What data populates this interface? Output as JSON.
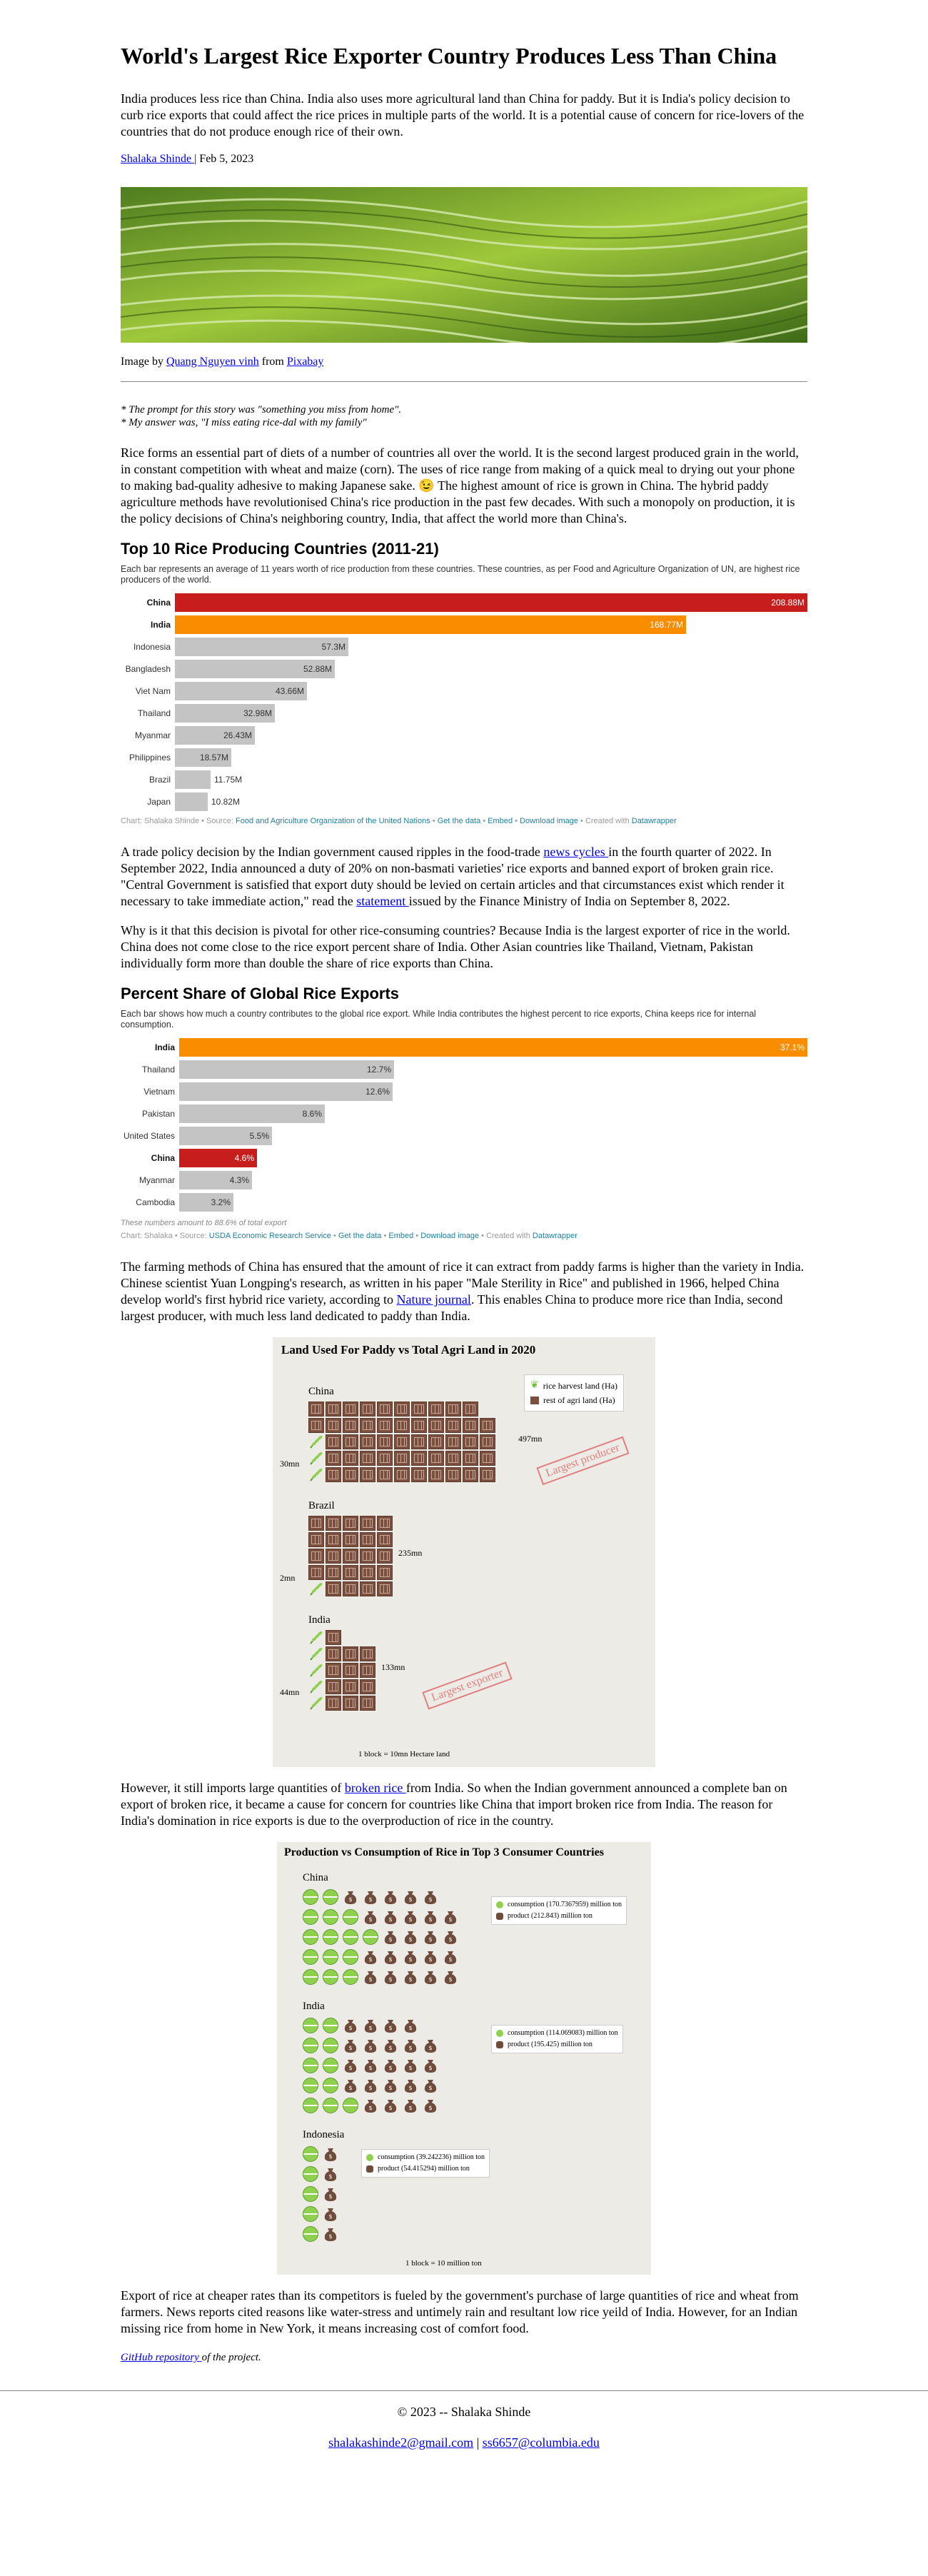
{
  "article": {
    "title": "World's Largest Rice Exporter Country Produces Less Than China",
    "intro": "India produces less rice than China. India also uses more agricultural land than China for paddy. But it is India's policy decision to curb rice exports that could affect the rice prices in multiple parts of the world. It is a potential cause of concern for rice-lovers of the countries that do not produce enough rice of their own.",
    "author": "Shalaka Shinde ",
    "date": " | Feb 5, 2023",
    "caption_pre": "Image by ",
    "caption_author": "Quang Nguyen vinh",
    "caption_mid": " from ",
    "caption_source": "Pixabay",
    "prompt_line1": "* The prompt for this story was \"something you miss from home\".",
    "prompt_line2": "* My answer was, \"I miss eating rice-dal with my family\"",
    "para1_a": "Rice forms an essential part of diets of a number of countries all over the world. It is the second largest produced grain in the world, in constant competition with wheat and maize (corn). The uses of rice range from making of a quick meal to drying out your phone to making bad-quality adhesive to making Japanese sake. ",
    "para1_emoji": "😉",
    "para1_b": " The highest amount of rice is grown in China. The hybrid paddy agriculture methods have revolutionised China's rice production in the past few decades. With such a monopoly on production, it is the policy decisions of China's neighboring country, India, that affect the world more than China's.",
    "para2_a": "A trade policy decision by the Indian government caused ripples in the food-trade ",
    "para2_link1": "news cycles ",
    "para2_b": "in the fourth quarter of 2022. In September 2022, India announced a duty of 20% on non-basmati varieties' rice exports and banned export of broken grain rice. \"Central Government is satisfied that export duty should be levied on certain articles and that circumstances exist which render it necessary to take immediate action,\" read the ",
    "para2_link2": "statement ",
    "para2_c": "issued by the Finance Ministry of India on September 8, 2022.",
    "para3": "Why is it that this decision is pivotal for other rice-consuming countries? Because India is the largest exporter of rice in the world. China does not come close to the rice export percent share of India. Other Asian countries like Thailand, Vietnam, Pakistan individually form more than double the share of rice exports than China.",
    "para4_a": "The farming methods of China has ensured that the amount of rice it can extract from paddy farms is higher than the variety in India. Chinese scientist Yuan Longping's research, as written in his paper \"Male Sterility in Rice\" and published in 1966, helped China develop world's first hybrid rice variety, according to ",
    "para4_link": "Nature journal",
    "para4_b": ". This enables China to produce more rice than India, second largest producer, with much less land dedicated to paddy than India.",
    "para5_a": "However, it still imports large quantities of ",
    "para5_link": "broken rice ",
    "para5_b": "from India. So when the Indian government announced a complete ban on export of broken rice, it became a cause for concern for countries like China that import broken rice from India. The reason for India's domination in rice exports is due to the overproduction of rice in the country.",
    "para6": "Export of rice at cheaper rates than its competitors is fueled by the government's purchase of large quantities of rice and wheat from farmers. News reports cited reasons like water-stress and untimely rain and resultant low rice yeild of India. However, for an Indian missing rice from home in New York, it means increasing cost of comfort food.",
    "github_link": "GitHub repository ",
    "github_tail": "of the project."
  },
  "chart_data": [
    {
      "type": "bar",
      "title": "Top 10 Rice Producing Countries (2011-21)",
      "description": "Each bar represents an average of 11 years worth of rice production from these countries. These countries, as per Food and Agriculture Organization of UN, are highest rice producers of the world.",
      "categories": [
        "China",
        "India",
        "Indonesia",
        "Bangladesh",
        "Viet Nam",
        "Thailand",
        "Myanmar",
        "Philippines",
        "Brazil",
        "Japan"
      ],
      "values": [
        208.88,
        168.77,
        57.3,
        52.88,
        43.66,
        32.98,
        26.43,
        18.57,
        11.75,
        10.82
      ],
      "value_labels": [
        "208.88M",
        "168.77M",
        "57.3M",
        "52.88M",
        "43.66M",
        "32.98M",
        "26.43M",
        "18.57M",
        "11.75M",
        "10.82M"
      ],
      "bold": [
        true,
        true,
        false,
        false,
        false,
        false,
        false,
        false,
        false,
        false
      ],
      "colors": [
        "#c71e1d",
        "#fa8c00",
        "#c4c4c4",
        "#c4c4c4",
        "#c4c4c4",
        "#c4c4c4",
        "#c4c4c4",
        "#c4c4c4",
        "#c4c4c4",
        "#c4c4c4"
      ],
      "xlim": [
        0,
        208.88
      ],
      "footer": {
        "chart_by": "Chart: Shalaka Shinde • Source: ",
        "source": "Food and Agriculture Organization of the United Nations",
        "get_data": "Get the data",
        "embed": "Embed",
        "download": "Download image",
        "created": "Created with ",
        "tool": "Datawrapper"
      }
    },
    {
      "type": "bar",
      "title": "Percent Share of Global Rice Exports",
      "description": "Each bar shows how much a country contributes to the global rice export. While India contributes the highest percent to rice exports, China keeps rice for internal consumption.",
      "categories": [
        "India",
        "Thailand",
        "Vietnam",
        "Pakistan",
        "United States",
        "China",
        "Myanmar",
        "Cambodia"
      ],
      "values": [
        37.1,
        12.7,
        12.6,
        8.6,
        5.5,
        4.6,
        4.3,
        3.2
      ],
      "value_labels": [
        "37.1%",
        "12.7%",
        "12.6%",
        "8.6%",
        "5.5%",
        "4.6%",
        "4.3%",
        "3.2%"
      ],
      "bold": [
        true,
        false,
        false,
        false,
        false,
        true,
        false,
        false
      ],
      "colors": [
        "#fa8c00",
        "#c4c4c4",
        "#c4c4c4",
        "#c4c4c4",
        "#c4c4c4",
        "#c71e1d",
        "#c4c4c4",
        "#c4c4c4"
      ],
      "xlim": [
        0,
        37.1
      ],
      "note": "These numbers amount to 88.6% of total export",
      "footer": {
        "chart_by": "Chart: Shalaka • Source: ",
        "source": "USDA Economic Research Service",
        "get_data": "Get the data",
        "embed": "Embed",
        "download": "Download image",
        "created": "Created with ",
        "tool": "Datawrapper"
      }
    }
  ],
  "land_chart": {
    "title": "Land Used For Paddy vs Total Agri Land in 2020",
    "legend_rice": "rice harvest land (Ha)",
    "legend_rest": "rest of agri land (Ha)",
    "unit_note": "1 block = 10mn Hectare land",
    "stamp_china": "Largest producer",
    "stamp_india": "Largest exporter",
    "countries": [
      {
        "name": "China",
        "rice_label": "30mn",
        "total_label": "497mn",
        "rice_blocks": 3,
        "total_blocks": 50
      },
      {
        "name": "Brazil",
        "rice_label": "2mn",
        "total_label": "235mn",
        "rice_blocks": 1,
        "total_blocks": 24
      },
      {
        "name": "India",
        "rice_label": "44mn",
        "total_label": "133mn",
        "rice_blocks": 5,
        "total_blocks": 14
      }
    ]
  },
  "consumption_chart": {
    "title": "Production vs Consumption of Rice in Top 3 Consumer Countries",
    "unit_note": "1 block = 10 million ton",
    "countries": [
      {
        "name": "China",
        "consumption_label": "consumption (170.7367959) million ton",
        "production_label": "product (212.843) million ton",
        "consumption": 17,
        "production": 21
      },
      {
        "name": "India",
        "consumption_label": "consumption (114.069083) million ton",
        "production_label": "product (195.425) million ton",
        "consumption": 11,
        "production": 20
      },
      {
        "name": "Indonesia",
        "consumption_label": "consumption (39.242236) million ton",
        "production_label": "product (54.415294) million ton",
        "consumption": 4,
        "production": 5
      }
    ]
  },
  "footer": {
    "copyright": "© 2023 -- Shalaka Shinde",
    "email1": "shalakashinde2@gmail.com",
    "separator": " | ",
    "email2": "ss6657@columbia.edu"
  }
}
